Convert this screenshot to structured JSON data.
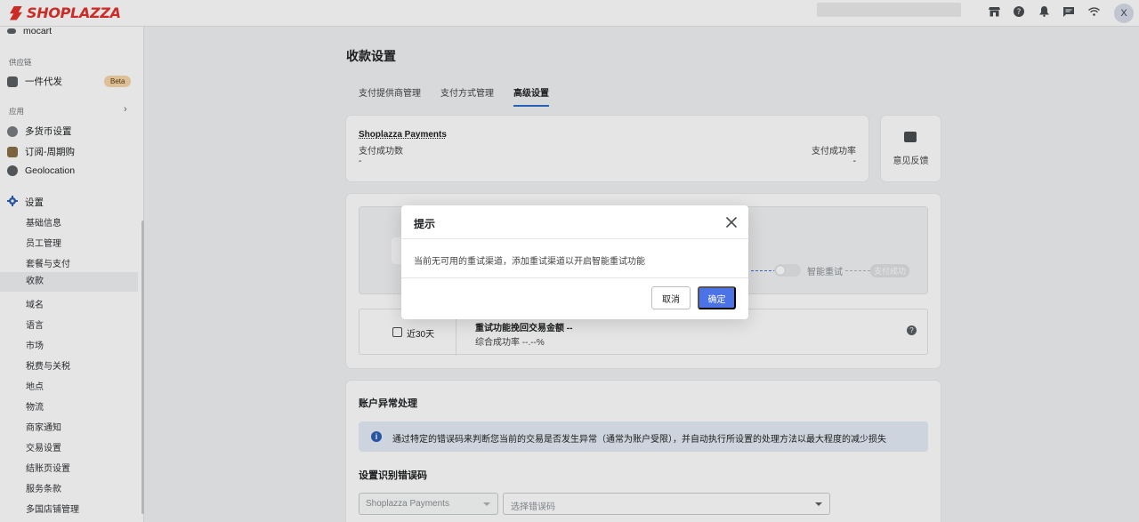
{
  "topbar": {
    "brand": "SHOPLAZZA",
    "avatar_initial": "X",
    "icons": [
      "store-icon",
      "help-icon",
      "bell-icon",
      "chat-icon",
      "wifi-icon"
    ]
  },
  "sidebar": {
    "top_item": "mocart",
    "section_supply": "供应链",
    "dropship": "一件代发",
    "beta_badge": "Beta",
    "section_apps": "应用",
    "apps": [
      "多货币设置",
      "订阅-周期购",
      "Geolocation"
    ],
    "settings": "设置",
    "settings_items": [
      "基础信息",
      "员工管理",
      "套餐与支付",
      "收款",
      "域名",
      "语言",
      "市场",
      "税费与关税",
      "地点",
      "物流",
      "商家通知",
      "交易设置",
      "结账页设置",
      "服务条款",
      "多国店铺管理"
    ],
    "active_item": "收款"
  },
  "main": {
    "title": "收款设置",
    "tabs": [
      "支付提供商管理",
      "支付方式管理",
      "高级设置"
    ],
    "active_tab": "高级设置",
    "payments_card": {
      "name": "Shoplazza Payments",
      "count_label": "支付成功数",
      "count_value": "-",
      "rate_label": "支付成功率",
      "rate_value": "-"
    },
    "feedback_label": "意见反馈",
    "retry": {
      "smart_retry_label": "智能重试",
      "pay_success_label": "支付成功",
      "range_label": "近30天",
      "amount_line": "重试功能挽回交易金额 --",
      "rate_line": "综合成功率 --.--%"
    },
    "account": {
      "title": "账户异常处理",
      "info": "通过特定的错误码来判断您当前的交易是否发生异常（通常为账户受限），并自动执行所设置的处理方法以最大程度的减少损失",
      "error_title": "设置识别错误码",
      "provider_value": "Shoplazza Payments",
      "error_placeholder": "选择错误码"
    }
  },
  "modal": {
    "title": "提示",
    "message": "当前无可用的重试渠道，添加重试渠道以开启智能重试功能",
    "cancel": "取消",
    "confirm": "确定"
  },
  "colors": {
    "brand": "#e4322b",
    "primary": "#4b73e6",
    "tab_underline": "#2c6ecb",
    "beta_bg": "#f8d5a7"
  }
}
